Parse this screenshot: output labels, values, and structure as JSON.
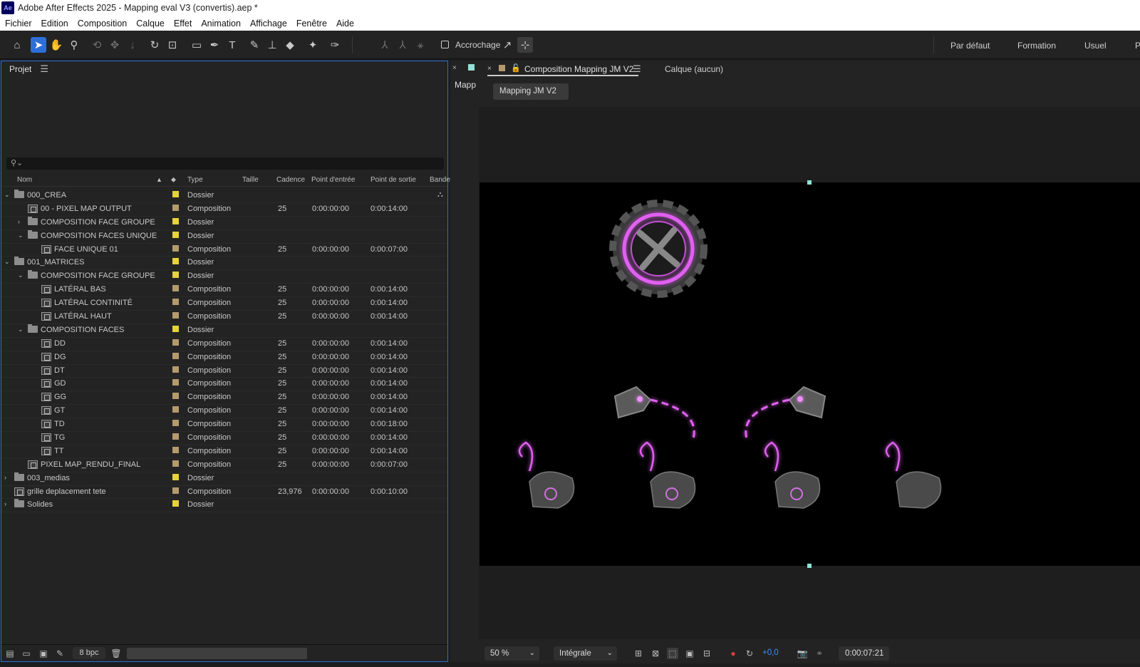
{
  "window": {
    "title": "Adobe After Effects 2025 - Mapping eval V3 (convertis).aep *",
    "logo": "Ae"
  },
  "menu": [
    "Fichier",
    "Edition",
    "Composition",
    "Calque",
    "Effet",
    "Animation",
    "Affichage",
    "Fenêtre",
    "Aide"
  ],
  "toolbar": {
    "snapping_label": "Accrochage",
    "workspaces": [
      "Par défaut",
      "Formation",
      "Usuel",
      "P"
    ]
  },
  "project": {
    "panel_title": "Projet",
    "search_icon": "search-icon",
    "columns": {
      "name": "Nom",
      "type": "Type",
      "size": "Taille",
      "rate": "Cadence",
      "in": "Point d'entrée",
      "out": "Point de sortie",
      "tape": "Bande"
    },
    "items": [
      {
        "name": "000_CREA",
        "type": "Dossier",
        "rate": "",
        "in": "",
        "out": "",
        "kind": "folder",
        "level": 0,
        "arrow": "open",
        "color": "#e6d23a"
      },
      {
        "name": "00 - PIXEL MAP OUTPUT",
        "type": "Composition",
        "rate": "25",
        "in": "0:00:00:00",
        "out": "0:00:14:00",
        "kind": "comp",
        "level": 1,
        "arrow": "",
        "color": "#b59a6e"
      },
      {
        "name": "COMPOSITION FACE GROUPE",
        "type": "Dossier",
        "rate": "",
        "in": "",
        "out": "",
        "kind": "folder",
        "level": 1,
        "arrow": "closed",
        "color": "#e6d23a"
      },
      {
        "name": "COMPOSITION FACES UNIQUE",
        "type": "Dossier",
        "rate": "",
        "in": "",
        "out": "",
        "kind": "folder",
        "level": 1,
        "arrow": "open",
        "color": "#e6d23a"
      },
      {
        "name": "FACE UNIQUE 01",
        "type": "Composition",
        "rate": "25",
        "in": "0:00:00:00",
        "out": "0:00:07:00",
        "kind": "comp",
        "level": 2,
        "arrow": "",
        "color": "#b59a6e"
      },
      {
        "name": "001_MATRICES",
        "type": "Dossier",
        "rate": "",
        "in": "",
        "out": "",
        "kind": "folder",
        "level": 0,
        "arrow": "open",
        "color": "#e6d23a"
      },
      {
        "name": "COMPOSITION FACE GROUPE",
        "type": "Dossier",
        "rate": "",
        "in": "",
        "out": "",
        "kind": "folder",
        "level": 1,
        "arrow": "open",
        "color": "#e6d23a"
      },
      {
        "name": "LATÉRAL BAS",
        "type": "Composition",
        "rate": "25",
        "in": "0:00:00:00",
        "out": "0:00:14:00",
        "kind": "comp",
        "level": 2,
        "arrow": "",
        "color": "#b59a6e"
      },
      {
        "name": "LATÉRAL CONTINITÉ",
        "type": "Composition",
        "rate": "25",
        "in": "0:00:00:00",
        "out": "0:00:14:00",
        "kind": "comp",
        "level": 2,
        "arrow": "",
        "color": "#b59a6e"
      },
      {
        "name": "LATÉRAL HAUT",
        "type": "Composition",
        "rate": "25",
        "in": "0:00:00:00",
        "out": "0:00:14:00",
        "kind": "comp",
        "level": 2,
        "arrow": "",
        "color": "#b59a6e"
      },
      {
        "name": "COMPOSITION FACES",
        "type": "Dossier",
        "rate": "",
        "in": "",
        "out": "",
        "kind": "folder",
        "level": 1,
        "arrow": "open",
        "color": "#e6d23a"
      },
      {
        "name": "DD",
        "type": "Composition",
        "rate": "25",
        "in": "0:00:00:00",
        "out": "0:00:14:00",
        "kind": "comp",
        "level": 2,
        "arrow": "",
        "color": "#b59a6e"
      },
      {
        "name": "DG",
        "type": "Composition",
        "rate": "25",
        "in": "0:00:00:00",
        "out": "0:00:14:00",
        "kind": "comp",
        "level": 2,
        "arrow": "",
        "color": "#b59a6e"
      },
      {
        "name": "DT",
        "type": "Composition",
        "rate": "25",
        "in": "0:00:00:00",
        "out": "0:00:14:00",
        "kind": "comp",
        "level": 2,
        "arrow": "",
        "color": "#b59a6e"
      },
      {
        "name": "GD",
        "type": "Composition",
        "rate": "25",
        "in": "0:00:00:00",
        "out": "0:00:14:00",
        "kind": "comp",
        "level": 2,
        "arrow": "",
        "color": "#b59a6e"
      },
      {
        "name": "GG",
        "type": "Composition",
        "rate": "25",
        "in": "0:00:00:00",
        "out": "0:00:14:00",
        "kind": "comp",
        "level": 2,
        "arrow": "",
        "color": "#b59a6e"
      },
      {
        "name": "GT",
        "type": "Composition",
        "rate": "25",
        "in": "0:00:00:00",
        "out": "0:00:14:00",
        "kind": "comp",
        "level": 2,
        "arrow": "",
        "color": "#b59a6e"
      },
      {
        "name": "TD",
        "type": "Composition",
        "rate": "25",
        "in": "0:00:00:00",
        "out": "0:00:18:00",
        "kind": "comp",
        "level": 2,
        "arrow": "",
        "color": "#b59a6e"
      },
      {
        "name": "TG",
        "type": "Composition",
        "rate": "25",
        "in": "0:00:00:00",
        "out": "0:00:14:00",
        "kind": "comp",
        "level": 2,
        "arrow": "",
        "color": "#b59a6e"
      },
      {
        "name": "TT",
        "type": "Composition",
        "rate": "25",
        "in": "0:00:00:00",
        "out": "0:00:14:00",
        "kind": "comp",
        "level": 2,
        "arrow": "",
        "color": "#b59a6e"
      },
      {
        "name": "PIXEL MAP_RENDU_FINAL",
        "type": "Composition",
        "rate": "25",
        "in": "0:00:00:00",
        "out": "0:00:07:00",
        "kind": "comp",
        "level": 1,
        "arrow": "",
        "color": "#b59a6e"
      },
      {
        "name": "003_medias",
        "type": "Dossier",
        "rate": "",
        "in": "",
        "out": "",
        "kind": "folder",
        "level": 0,
        "arrow": "closed",
        "color": "#e6d23a"
      },
      {
        "name": "grille deplacement tete",
        "type": "Composition",
        "rate": "23,976",
        "in": "0:00:00:00",
        "out": "0:00:10:00",
        "kind": "comp",
        "level": 0,
        "arrow": "",
        "color": "#b59a6e"
      },
      {
        "name": "Solides",
        "type": "Dossier",
        "rate": "",
        "in": "",
        "out": "",
        "kind": "folder",
        "level": 0,
        "arrow": "closed",
        "color": "#e6d23a"
      }
    ],
    "bit_depth": "8 bpc"
  },
  "strip": {
    "label": "Mapp"
  },
  "viewer": {
    "tab_title": "Composition Mapping JM V2",
    "layer_tab": "Calque (aucun)",
    "breadcrumb": "Mapping JM V2",
    "zoom": "50 %",
    "resolution": "Intégrale",
    "exposure": "+0,0",
    "timecode": "0:00:07:21"
  },
  "colors": {
    "accent": "#2d6fd8",
    "glow": "#e060f0",
    "folder_label": "#e6d23a",
    "comp_label": "#b59a6e"
  }
}
